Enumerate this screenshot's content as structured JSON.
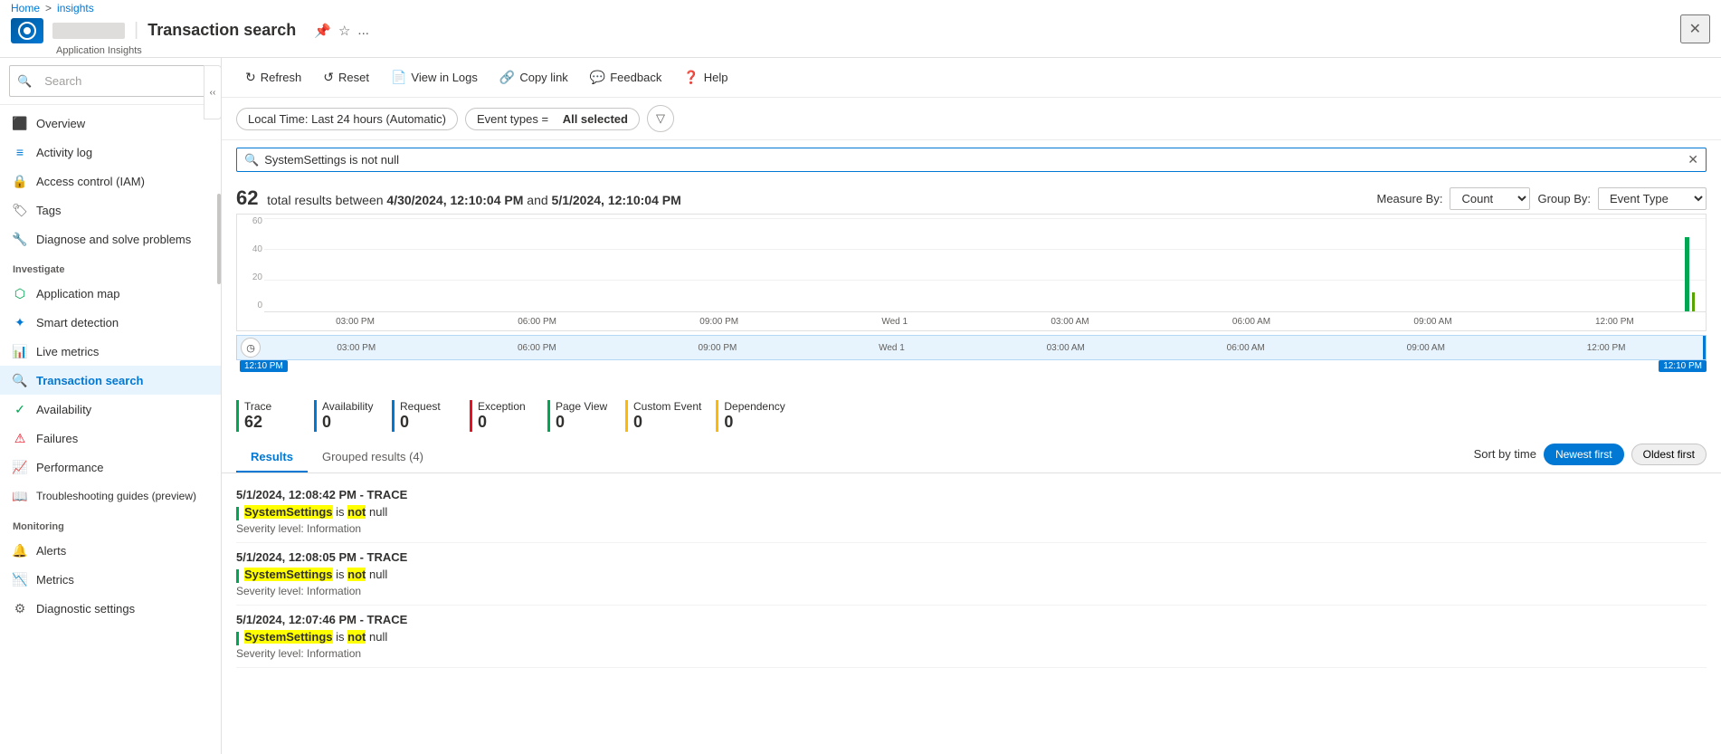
{
  "breadcrumb": {
    "home": "Home",
    "separator": ">",
    "current": "insights"
  },
  "titlebar": {
    "app_name": "Transaction search",
    "subtitle": "Application Insights",
    "pin_icon": "📌",
    "star_icon": "☆",
    "more_icon": "...",
    "close_icon": "✕"
  },
  "toolbar": {
    "refresh_label": "Refresh",
    "reset_label": "Reset",
    "view_in_logs_label": "View in Logs",
    "copy_link_label": "Copy link",
    "feedback_label": "Feedback",
    "help_label": "Help"
  },
  "filters": {
    "time_filter": "Local Time: Last 24 hours (Automatic)",
    "event_filter_prefix": "Event types =",
    "event_filter_value": "All selected"
  },
  "search": {
    "placeholder": "Search",
    "value": "SystemSettings is not null",
    "clear_icon": "✕"
  },
  "results": {
    "count": 62,
    "summary_prefix": "total results between",
    "start_date": "4/30/2024, 12:10:04 PM",
    "and": "and",
    "end_date": "5/1/2024, 12:10:04 PM",
    "measure_label": "Measure By:",
    "measure_value": "Count",
    "group_label": "Group By:",
    "group_value": "Event Type"
  },
  "chart": {
    "y_labels": [
      "60",
      "40",
      "20",
      "0"
    ],
    "x_labels": [
      "03:00 PM",
      "06:00 PM",
      "09:00 PM",
      "Wed 1",
      "03:00 AM",
      "06:00 AM",
      "09:00 AM",
      "12:00 PM"
    ]
  },
  "timeline": {
    "start_label": "12:10 PM",
    "end_label": "12:10 PM",
    "x_labels": [
      "03:00 PM",
      "06:00 PM",
      "09:00 PM",
      "Wed 1",
      "03:00 AM",
      "06:00 AM",
      "09:00 AM",
      "12:00 PM"
    ]
  },
  "event_counts": [
    {
      "label": "Trace",
      "count": "62",
      "color": "#00a651"
    },
    {
      "label": "Availability",
      "count": "0",
      "color": "#0078d4"
    },
    {
      "label": "Request",
      "count": "0",
      "color": "#0078d4"
    },
    {
      "label": "Exception",
      "count": "0",
      "color": "#e81123"
    },
    {
      "label": "Page View",
      "count": "0",
      "color": "#00a651"
    },
    {
      "label": "Custom Event",
      "count": "0",
      "color": "#ffb900"
    },
    {
      "label": "Dependency",
      "count": "0",
      "color": "#ffb900"
    }
  ],
  "tabs": [
    {
      "label": "Results",
      "active": true
    },
    {
      "label": "Grouped results (4)",
      "active": false
    }
  ],
  "sort": {
    "label": "Sort by time",
    "newest": "Newest first",
    "oldest": "Oldest first"
  },
  "result_items": [
    {
      "timestamp": "5/1/2024, 12:08:42 PM",
      "type": "TRACE",
      "message_parts": [
        "SystemSettings",
        " is ",
        "not",
        " null"
      ],
      "highlight_words": [
        0,
        2
      ],
      "severity": "Severity level: Information"
    },
    {
      "timestamp": "5/1/2024, 12:08:05 PM",
      "type": "TRACE",
      "message_parts": [
        "SystemSettings",
        " is ",
        "not",
        " null"
      ],
      "highlight_words": [
        0,
        2
      ],
      "severity": "Severity level: Information"
    },
    {
      "timestamp": "5/1/2024, 12:07:46 PM",
      "type": "TRACE",
      "message_parts": [
        "SystemSettings",
        " is ",
        "not",
        " null"
      ],
      "highlight_words": [
        0,
        2
      ],
      "severity": "Severity level: Information"
    }
  ],
  "sidebar": {
    "search_placeholder": "Search",
    "nav_items": [
      {
        "label": "Overview",
        "icon": "⬛",
        "section": null,
        "active": false
      },
      {
        "label": "Activity log",
        "icon": "📋",
        "section": null,
        "active": false
      },
      {
        "label": "Access control (IAM)",
        "icon": "🔒",
        "section": null,
        "active": false
      },
      {
        "label": "Tags",
        "icon": "🏷",
        "section": null,
        "active": false
      },
      {
        "label": "Diagnose and solve problems",
        "icon": "🔧",
        "section": null,
        "active": false
      },
      {
        "label": "Investigate",
        "icon": null,
        "section": "Investigate",
        "active": false
      },
      {
        "label": "Application map",
        "icon": "🗺",
        "section": null,
        "active": false
      },
      {
        "label": "Smart detection",
        "icon": "⚡",
        "section": null,
        "active": false
      },
      {
        "label": "Live metrics",
        "icon": "📊",
        "section": null,
        "active": false
      },
      {
        "label": "Transaction search",
        "icon": "🔍",
        "section": null,
        "active": true
      },
      {
        "label": "Availability",
        "icon": "✓",
        "section": null,
        "active": false
      },
      {
        "label": "Failures",
        "icon": "⚠",
        "section": null,
        "active": false
      },
      {
        "label": "Performance",
        "icon": "📈",
        "section": null,
        "active": false
      },
      {
        "label": "Troubleshooting guides (preview)",
        "icon": "📖",
        "section": null,
        "active": false
      },
      {
        "label": "Monitoring",
        "icon": null,
        "section": "Monitoring",
        "active": false
      },
      {
        "label": "Alerts",
        "icon": "🔔",
        "section": null,
        "active": false
      },
      {
        "label": "Metrics",
        "icon": "📉",
        "section": null,
        "active": false
      },
      {
        "label": "Diagnostic settings",
        "icon": "⚙",
        "section": null,
        "active": false
      }
    ]
  }
}
